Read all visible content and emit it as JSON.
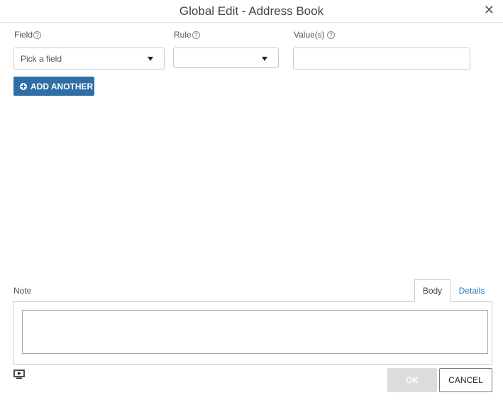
{
  "dialog": {
    "title": "Global Edit - Address Book",
    "close_glyph": "✕"
  },
  "filters": {
    "field_label": "Field",
    "rule_label": "Rule",
    "values_label": "Value(s)",
    "help_glyph": "?",
    "field_select_value": "Pick a field",
    "rule_select_value": "",
    "values_input_value": "",
    "add_another_label": "ADD ANOTHER"
  },
  "note": {
    "label": "Note",
    "tabs": [
      {
        "label": "Body",
        "active": true
      },
      {
        "label": "Details",
        "active": false
      }
    ],
    "text": ""
  },
  "footer": {
    "ok_label": "OK",
    "ok_enabled": false,
    "cancel_label": "CANCEL"
  },
  "icons": [
    "close-icon",
    "help-icon",
    "chevron-down-icon",
    "plus-circle-icon",
    "play-video-icon"
  ],
  "colors": {
    "primary": "#2f6ea5",
    "link": "#2f7ab8",
    "disabled": "#dcdcdc"
  }
}
